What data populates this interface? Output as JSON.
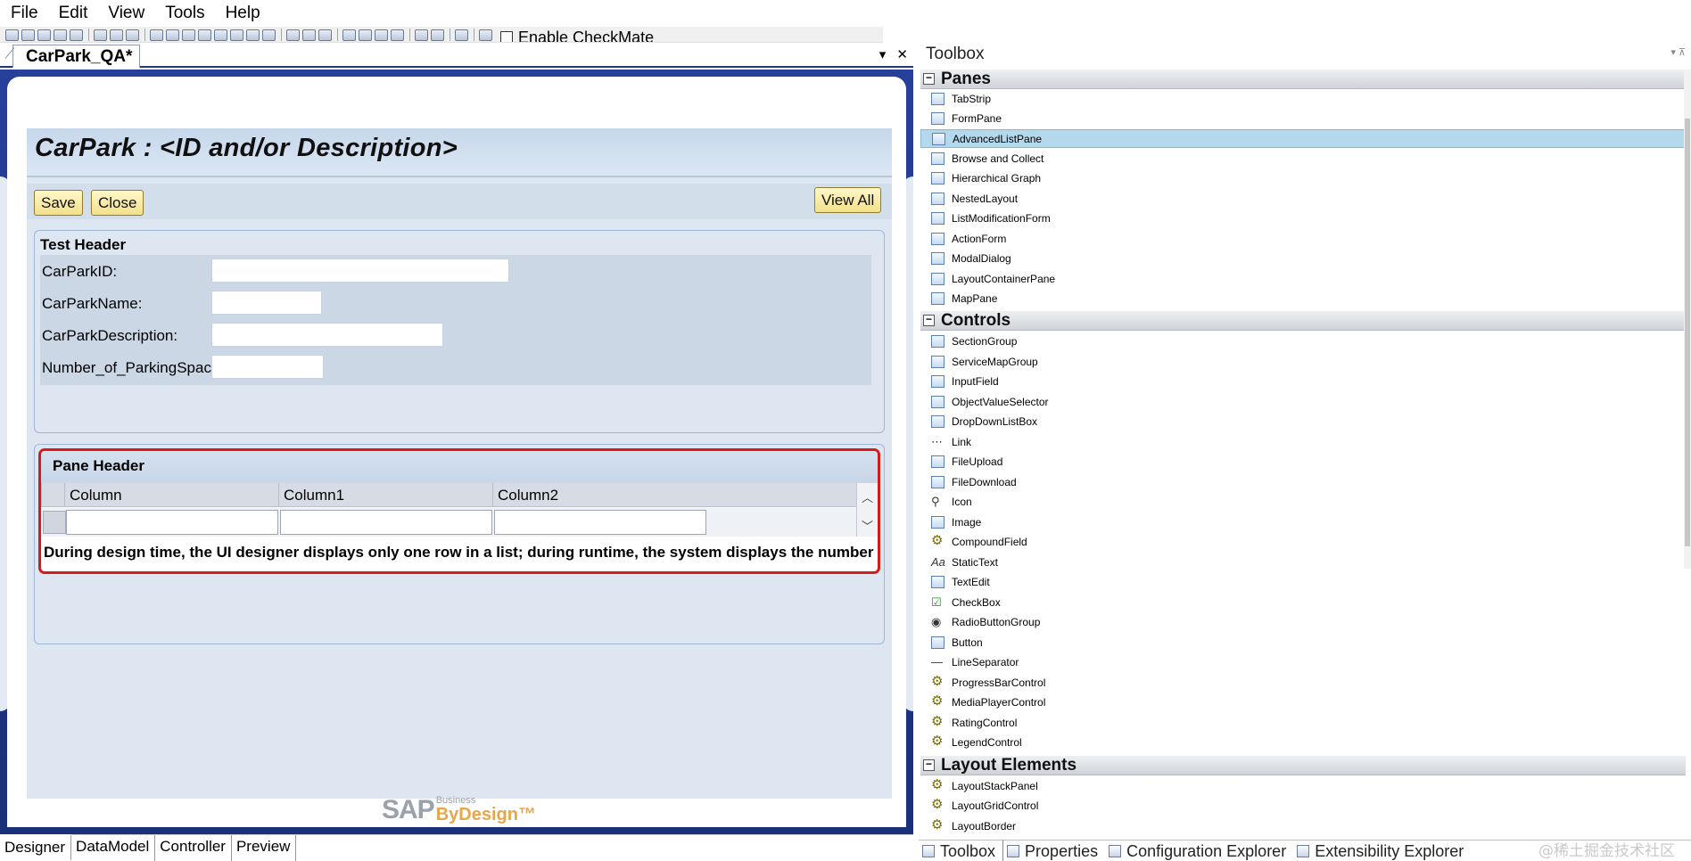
{
  "menu": [
    "File",
    "Edit",
    "View",
    "Tools",
    "Help"
  ],
  "toolbar": {
    "checkmate_label": "Enable CheckMate"
  },
  "document_tab": {
    "title": "CarPark_QA*",
    "dropdown": "▾",
    "close": "✕"
  },
  "floorplan": {
    "title": "CarPark : <ID and/or Description>",
    "buttons": {
      "save": "Save",
      "close": "Close",
      "view_all": "View All"
    },
    "section": {
      "header": "Test Header",
      "fields": [
        {
          "label": "CarParkID:",
          "value": ""
        },
        {
          "label": "CarParkName:",
          "value": ""
        },
        {
          "label": "CarParkDescription:",
          "value": ""
        },
        {
          "label": "Number_of_ParkingSpaces:",
          "value": ""
        }
      ]
    },
    "list_pane": {
      "header": "Pane Header",
      "columns": [
        "Column",
        "Column1",
        "Column2"
      ],
      "note": "During design time, the UI designer displays only one row in a list; during runtime, the system displays the number o"
    },
    "logo": {
      "sap": "SAP",
      "business": "Business",
      "bydesign": "ByDesign™"
    }
  },
  "designer_tabs": [
    "Designer",
    "DataModel",
    "Controller",
    "Preview"
  ],
  "toolbox": {
    "title": "Toolbox",
    "groups": [
      {
        "name": "Panes",
        "items": [
          "TabStrip",
          "FormPane",
          "AdvancedListPane",
          "Browse and Collect",
          "Hierarchical Graph",
          "NestedLayout",
          "ListModificationForm",
          "ActionForm",
          "ModalDialog",
          "LayoutContainerPane",
          "MapPane"
        ]
      },
      {
        "name": "Controls",
        "items": [
          "SectionGroup",
          "ServiceMapGroup",
          "InputField",
          "ObjectValueSelector",
          "DropDownListBox",
          "Link",
          "FileUpload",
          "FileDownload",
          "Icon",
          "Image",
          "CompoundField",
          "StaticText",
          "TextEdit",
          "CheckBox",
          "RadioButtonGroup",
          "Button",
          "LineSeparator",
          "ProgressBarControl",
          "MediaPlayerControl",
          "RatingControl",
          "LegendControl"
        ]
      },
      {
        "name": "Layout Elements",
        "items": [
          "LayoutStackPanel",
          "LayoutGridControl",
          "LayoutBorder"
        ]
      }
    ],
    "selected_item": "AdvancedListPane"
  },
  "tool_tabs": [
    "Toolbox",
    "Properties",
    "Configuration Explorer",
    "Extensibility Explorer"
  ],
  "watermark": "@稀土掘金技术社区"
}
